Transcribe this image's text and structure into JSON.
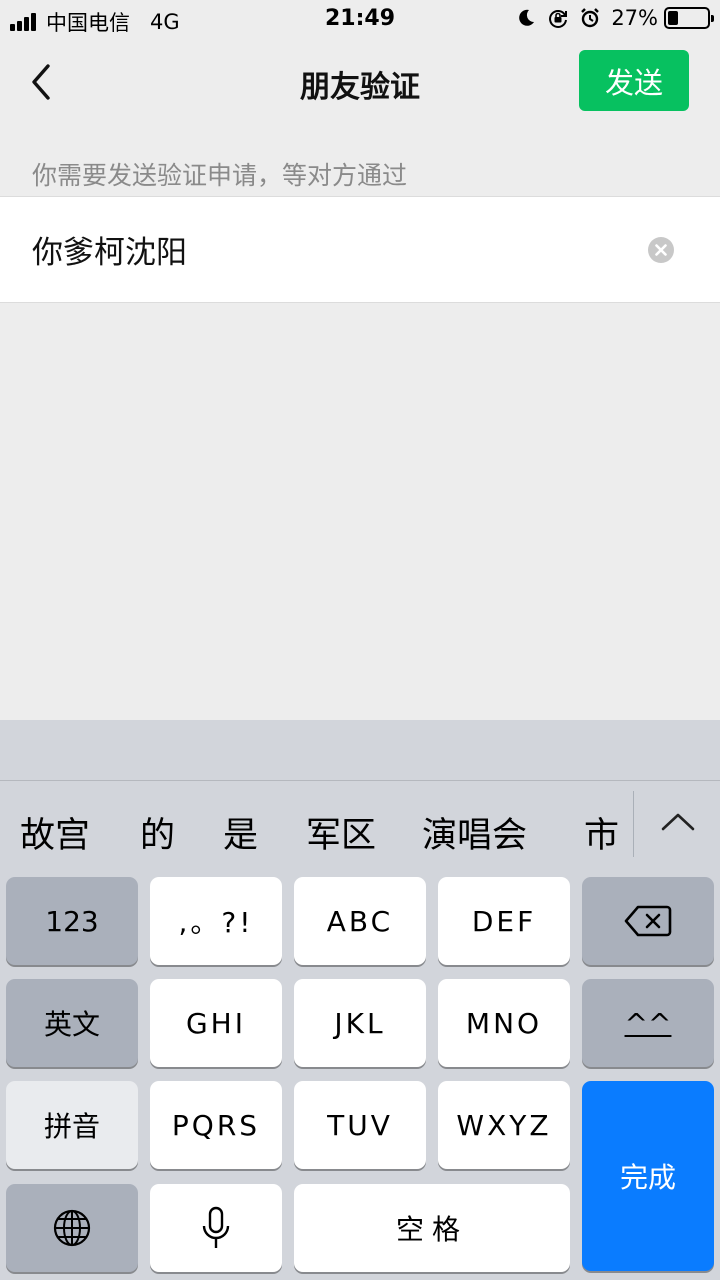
{
  "status_bar": {
    "carrier": "中国电信",
    "network": "4G",
    "time": "21:49",
    "battery_percent": "27%",
    "battery_level": 0.27,
    "icons": [
      "moon-icon",
      "rotation-lock-icon",
      "alarm-icon"
    ]
  },
  "nav": {
    "title": "朋友验证",
    "send_label": "发送"
  },
  "hint_text": "你需要发送验证申请，等对方通过",
  "input": {
    "value": "你爹柯沈阳"
  },
  "keyboard": {
    "candidates": [
      "故宫",
      "的",
      "是",
      "军区",
      "演唱会",
      "市"
    ],
    "rows": [
      [
        "123",
        ",。?!",
        "ABC",
        "DEF"
      ],
      [
        "英文",
        "GHI",
        "JKL",
        "MNO",
        "^^"
      ],
      [
        "拼音",
        "PQRS",
        "TUV",
        "WXYZ"
      ],
      [
        "",
        "",
        "空格"
      ]
    ],
    "done_label": "完成"
  },
  "colors": {
    "accent": "#07c160",
    "done_key": "#0a7cff",
    "background": "#ededed",
    "keyboard_bg": "#d2d5db"
  }
}
